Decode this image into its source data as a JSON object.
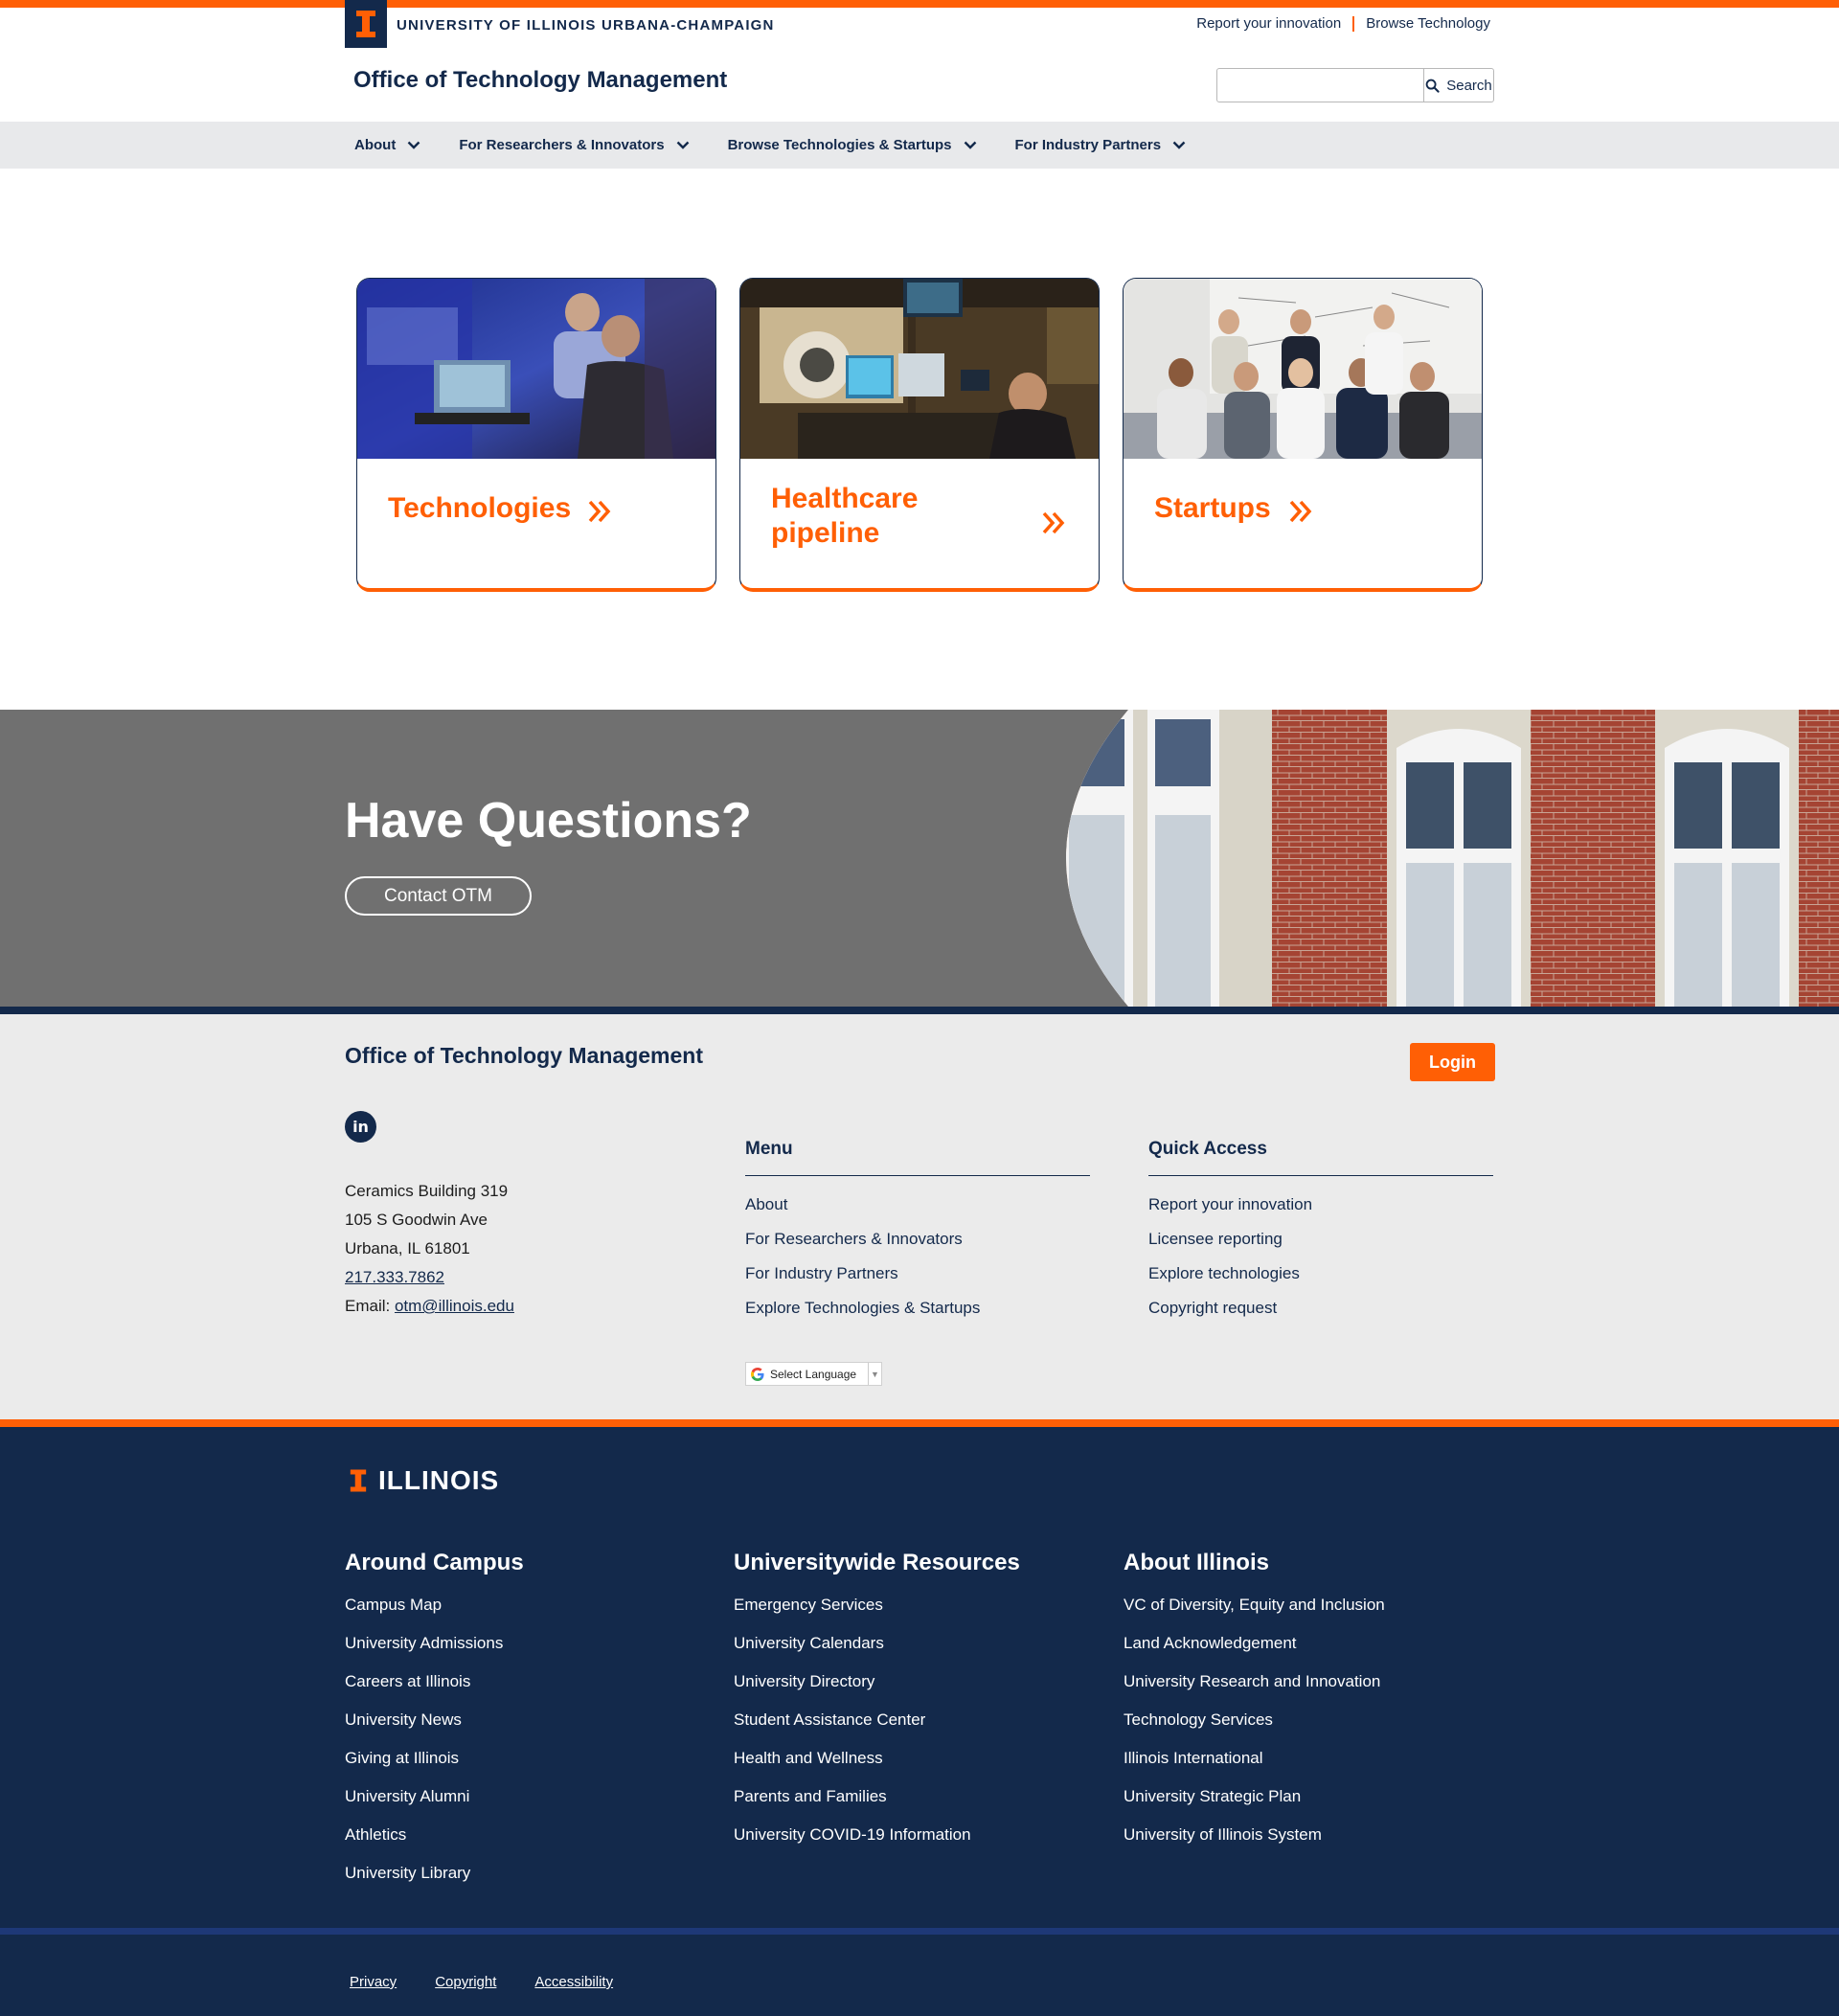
{
  "header": {
    "university_name": "UNIVERSITY OF ILLINOIS URBANA-CHAMPAIGN",
    "utility_links": [
      "Report your innovation",
      "Browse Technology"
    ],
    "site_title": "Office of Technology Management",
    "search": {
      "placeholder": "",
      "button_label": "Search"
    }
  },
  "nav": {
    "items": [
      {
        "label": "About"
      },
      {
        "label": "For Researchers & Innovators"
      },
      {
        "label": "Browse Technologies & Startups"
      },
      {
        "label": "For Industry Partners"
      }
    ]
  },
  "cards": [
    {
      "label": "Technologies"
    },
    {
      "label_line1": "Healthcare",
      "label_line2": "pipeline"
    },
    {
      "label": "Startups"
    }
  ],
  "questions": {
    "title": "Have Questions?",
    "button_label": "Contact OTM"
  },
  "footer": {
    "title": "Office of Technology Management",
    "login_label": "Login",
    "linkedin_label": "in",
    "address": [
      "Ceramics Building 319",
      "105 S Goodwin Ave",
      "Urbana, IL 61801"
    ],
    "phone": "217.333.7862",
    "email_label": "Email:",
    "email": "otm@illinois.edu",
    "menu": {
      "heading": "Menu",
      "items": [
        "About",
        "For Researchers & Innovators",
        "For Industry Partners",
        "Explore Technologies & Startups"
      ]
    },
    "quick_access": {
      "heading": "Quick Access",
      "items": [
        "Report your innovation",
        "Licensee reporting",
        "Explore technologies",
        "Copyright request"
      ]
    },
    "language_label": "Select Language"
  },
  "footer_dark": {
    "logo_text": "ILLINOIS",
    "columns": [
      {
        "heading": "Around Campus",
        "items": [
          "Campus Map",
          "University Admissions",
          "Careers at Illinois",
          "University News",
          "Giving at Illinois",
          "University Alumni",
          "Athletics",
          "University Library"
        ]
      },
      {
        "heading": "Universitywide Resources",
        "items": [
          "Emergency Services",
          "University Calendars",
          "University Directory",
          "Student Assistance Center",
          "Health and Wellness",
          "Parents and Families",
          "University COVID-19 Information"
        ]
      },
      {
        "heading": "About Illinois",
        "items": [
          "VC of Diversity, Equity and Inclusion",
          "Land Acknowledgement",
          "University Research and Innovation",
          "Technology Services",
          "Illinois International",
          "University Strategic Plan",
          "University of Illinois System"
        ]
      }
    ],
    "legal_links": [
      "Privacy",
      "Copyright",
      "Accessibility"
    ]
  },
  "colors": {
    "brand_orange": "#ff5f05",
    "brand_navy": "#13294b",
    "nav_gray": "#e8e9eb",
    "band_gray": "#707070"
  }
}
